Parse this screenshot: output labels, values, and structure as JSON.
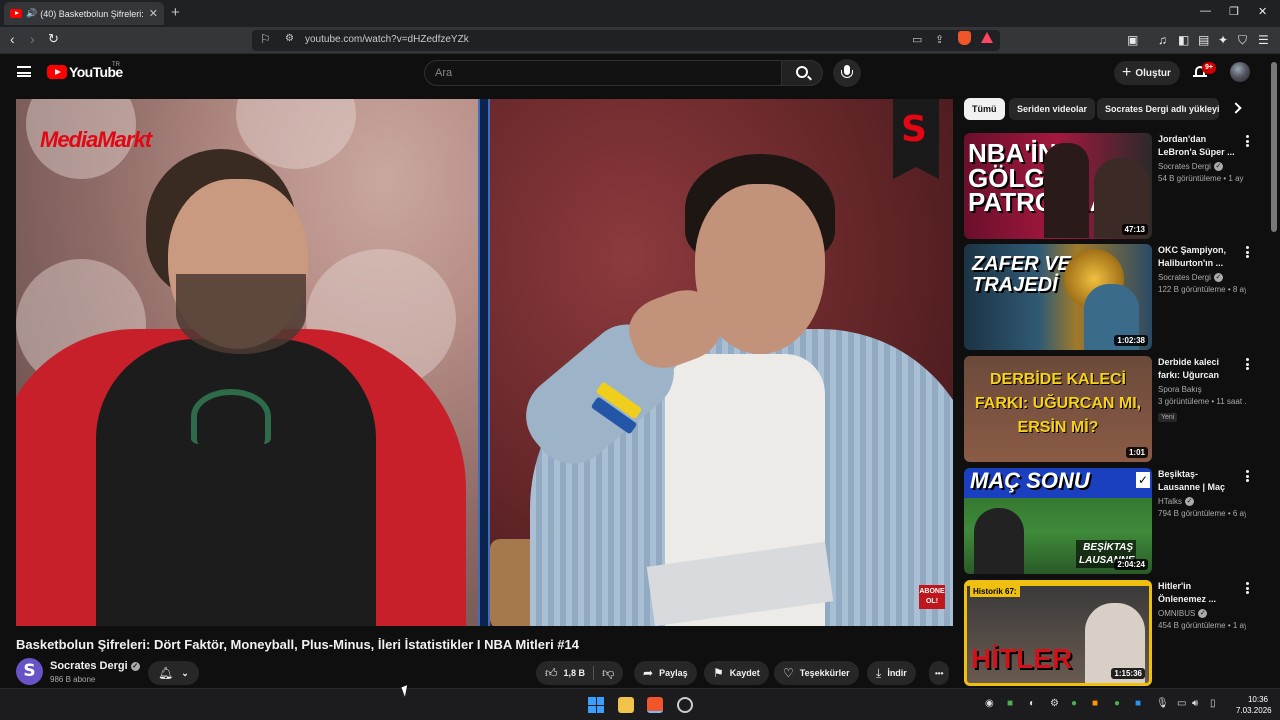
{
  "browser": {
    "tab_title": "(40) Basketbolun Şifreleri: Dö",
    "url": "youtube.com/watch?v=dHZedfzeYZk",
    "new_tab": "+",
    "close": "✕"
  },
  "youtube": {
    "logo_text": "YouTube",
    "country_code": "TR",
    "search_placeholder": "Ara",
    "create_label": "Oluştur",
    "notifications_badge": "9+"
  },
  "video": {
    "overlay_brand": "MediaMarkt",
    "channel_mark": "S",
    "subscribe_overlay": "ABONE OL!",
    "title": "Basketbolun Şifreleri: Dört Faktör, Moneyball, Plus-Minus, İleri İstatistikler I NBA Mitleri #14",
    "channel": "Socrates Dergi",
    "channel_initial": "S",
    "subscribers": "986 B abone",
    "likes": "1,8 B",
    "share_label": "Paylaş",
    "save_label": "Kaydet",
    "thanks_label": "Teşekkürler",
    "download_label": "İndir",
    "more_label": "•••"
  },
  "chips": [
    "Tümü",
    "Seriden videolar",
    "Socrates Dergi adlı yükleyici"
  ],
  "recommendations": [
    {
      "title": "Jordan'dan LeBron'a Süper ...",
      "channel": "Socrates Dergi",
      "verified": true,
      "meta": "54 B görüntüleme • 1 ay ...",
      "duration": "47:13",
      "thumb_text": "NBA'İN GÖLGE PATRONLARI",
      "new": ""
    },
    {
      "title": "OKC Şampiyon, Haliburton'ın ...",
      "channel": "Socrates Dergi",
      "verified": true,
      "meta": "122 B görüntüleme • 8 ay ...",
      "duration": "1:02:38",
      "thumb_text": "ZAFER VE TRAJEDİ",
      "new": ""
    },
    {
      "title": "Derbide kaleci farkı: Uğurcan mı,...",
      "channel": "Spora Bakış",
      "verified": false,
      "meta": "3 görüntüleme • 11 saat ...",
      "duration": "1:01",
      "thumb_text": "DERBİDE KALECİ FARKI: UĞURCAN MI, ERSİN Mİ?",
      "new": "Yeni"
    },
    {
      "title": "Beşiktaş-Lausanne | Maç Sonu ...",
      "channel": "HTalks",
      "verified": true,
      "meta": "794 B görüntüleme • 6 ay ...",
      "duration": "2:04:24",
      "thumb_text": "MAÇ SONU",
      "thumb_text_2": "BEŞİKTAŞ LAUSANNE",
      "new": ""
    },
    {
      "title": "Hitler'in Önlenemez ...",
      "channel": "OMNIBUS",
      "verified": true,
      "meta": "454 B görüntüleme • 1 ay ...",
      "duration": "1:15:36",
      "thumb_text": "HİTLER",
      "thumb_tag": "Historik 67:",
      "new": ""
    }
  ],
  "taskbar": {
    "time": "10:36",
    "date": "7.03.2026"
  },
  "colors": {
    "accent": "#ff0000",
    "bg": "#0f0f0f",
    "chip_active": "#f1f1f1"
  }
}
